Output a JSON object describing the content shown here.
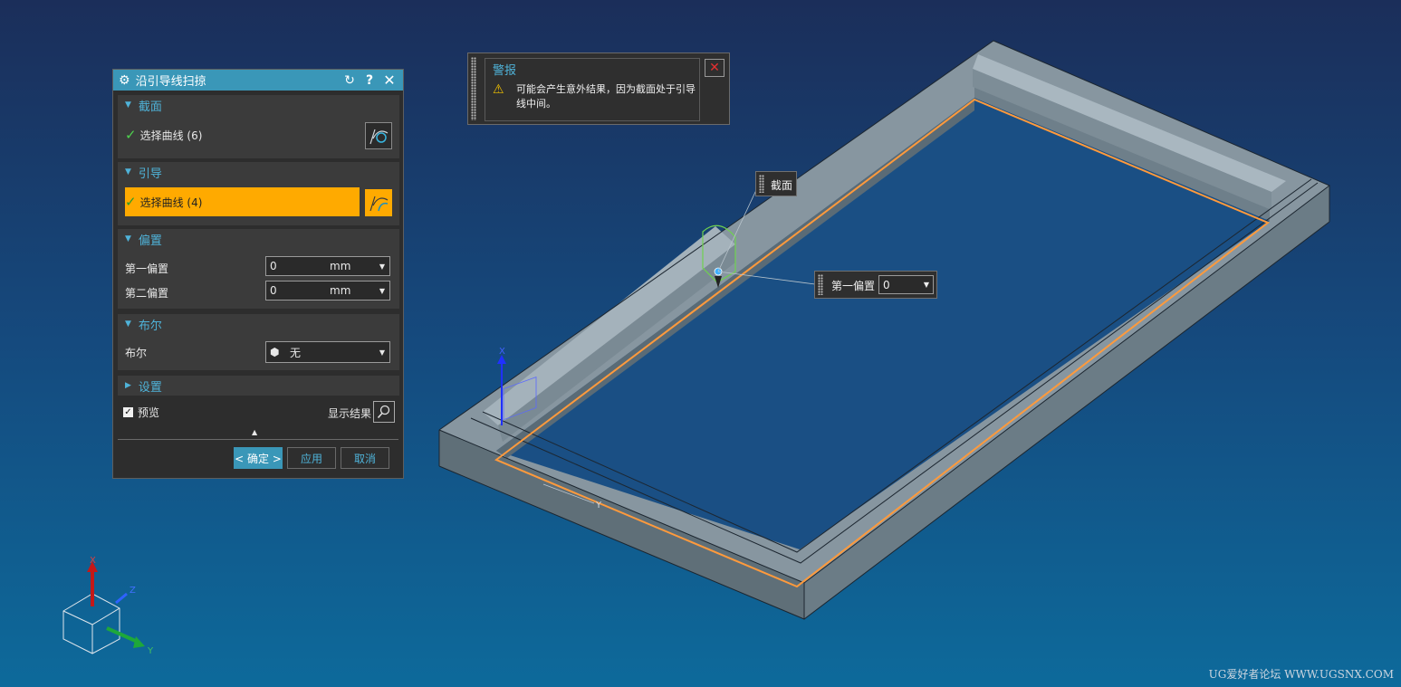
{
  "dialog": {
    "title": "沿引导线扫掠",
    "section_group": {
      "header": "截面",
      "select_label": "选择曲线 (6)"
    },
    "guide_group": {
      "header": "引导",
      "select_label": "选择曲线 (4)"
    },
    "offset_group": {
      "header": "偏置",
      "first_label": "第一偏置",
      "first_value": "0",
      "first_unit": "mm",
      "second_label": "第二偏置",
      "second_value": "0",
      "second_unit": "mm"
    },
    "boolean_group": {
      "header": "布尔",
      "label": "布尔",
      "value": "无"
    },
    "settings_group": {
      "header": "设置"
    },
    "preview_label": "预览",
    "show_result_label": "显示结果",
    "ok_label": "< 确定 >",
    "apply_label": "应用",
    "cancel_label": "取消"
  },
  "alert": {
    "title": "警报",
    "message": "可能会产生意外结果，因为截面处于引导线中间。"
  },
  "callouts": {
    "section_label": "截面",
    "offset_label": "第一偏置",
    "offset_value": "0"
  },
  "axes": {
    "x": "X",
    "y": "Y",
    "z": "Z"
  },
  "watermark": "UG爱好者论坛 WWW.UGSNX.COM",
  "colors": {
    "accent": "#3a97b8",
    "highlight": "#ffaa00",
    "guide_curve": "#ff9a3c",
    "section_curve": "#6fd24f"
  }
}
